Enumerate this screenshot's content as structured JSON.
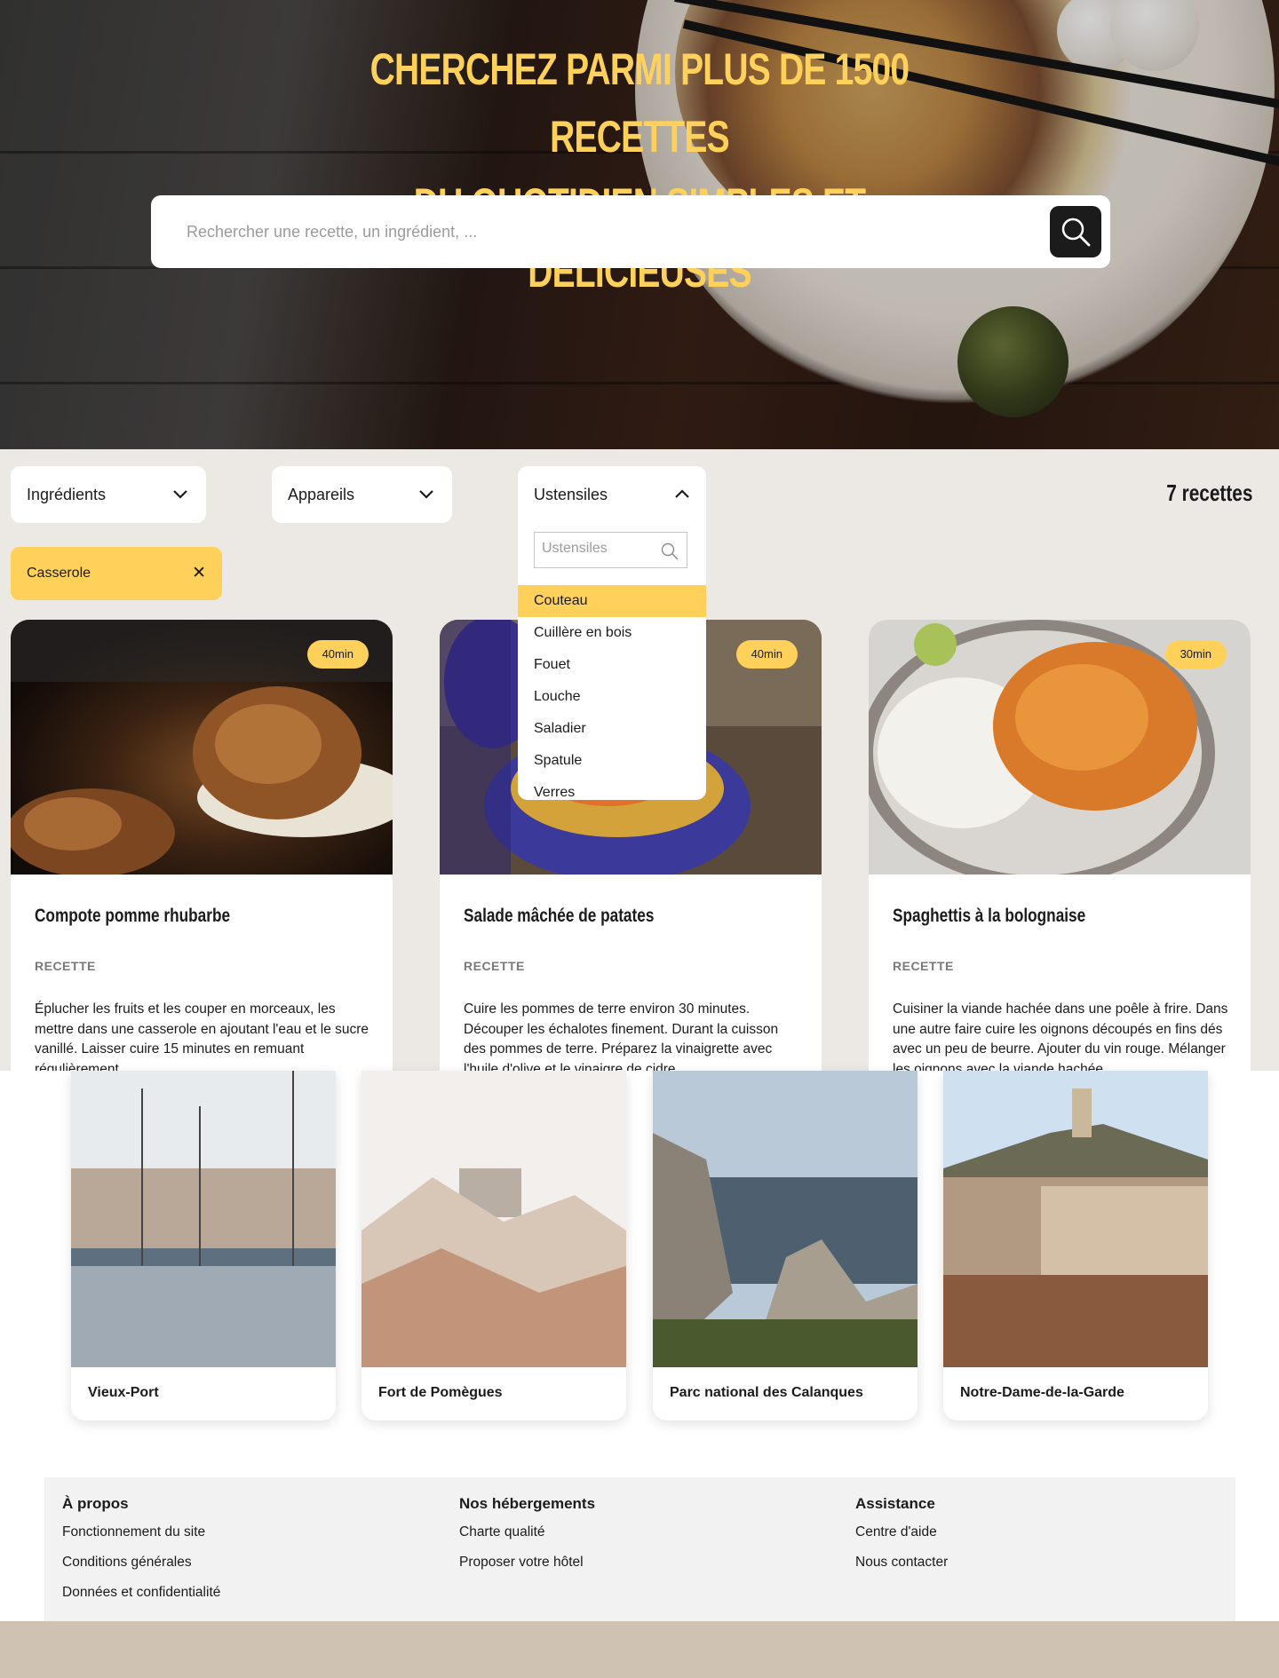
{
  "hero": {
    "headline_line1": "CHERCHEZ PARMI PLUS DE 1500 RECETTES",
    "headline_line2": "DU QUOTIDIEN,SIMPLES ET DÉLICIEUSES"
  },
  "search": {
    "placeholder": "Rechercher une recette, un ingrédient, ...",
    "button_icon": "search-icon"
  },
  "filters": {
    "ingredients_label": "Ingrédients",
    "appareils_label": "Appareils",
    "ustensiles_label": "Ustensiles",
    "ustensiles_search_placeholder": "Ustensiles",
    "ustensiles_options": [
      "Couteau",
      "Cuillère en bois",
      "Fouet",
      "Louche",
      "Saladier",
      "Spatule",
      "Verres"
    ],
    "highlighted_option": "Couteau"
  },
  "recipe_count": "7 recettes",
  "active_tags": [
    {
      "label": "Casserole",
      "remove_glyph": "✕"
    }
  ],
  "recipes": [
    {
      "time": "40min",
      "title": "Compote pomme rhubarbe",
      "kind": "RECETTE",
      "description": "Éplucher les fruits et les couper en morceaux, les mettre dans une casserole en ajoutant l'eau et le sucre vanillé. Laisser cuire 15 minutes en remuant régulièrement."
    },
    {
      "time": "40min",
      "title": "Salade mâchée de patates",
      "kind": "RECETTE",
      "description": "Cuire les pommes de terre environ 30 minutes. Découper les échalotes finement. Durant la cuisson des pommes de terre. Préparez la vinaigrette avec l'huile d'olive et le vinaigre de cidre."
    },
    {
      "time": "30min",
      "title": "Spaghettis à la bolognaise",
      "kind": "RECETTE",
      "description": "Cuisiner la viande hachée dans une poêle à frire. Dans une autre faire cuire les oignons découpés en fins dés avec un peu de beurre. Ajouter du vin rouge. Mélanger les oignons avec la viande hachée."
    }
  ],
  "places": [
    {
      "name": "Vieux-Port"
    },
    {
      "name": "Fort de Pomègues"
    },
    {
      "name": "Parc national des Calanques"
    },
    {
      "name": "Notre-Dame-de-la-Garde"
    }
  ],
  "footer": {
    "columns": [
      {
        "title": "À propos",
        "links": [
          "Fonctionnement du site",
          "Conditions générales",
          "Données et confidentialité"
        ]
      },
      {
        "title": "Nos hébergements",
        "links": [
          "Charte qualité",
          "Proposer votre hôtel"
        ]
      },
      {
        "title": "Assistance",
        "links": [
          "Centre d'aide",
          "Nous contacter"
        ]
      }
    ]
  },
  "colors": {
    "accent_yellow": "#ffd15b",
    "dark": "#1b1b1b",
    "filter_bg": "#ece9e4",
    "footer_band": "#cfc2b2"
  }
}
